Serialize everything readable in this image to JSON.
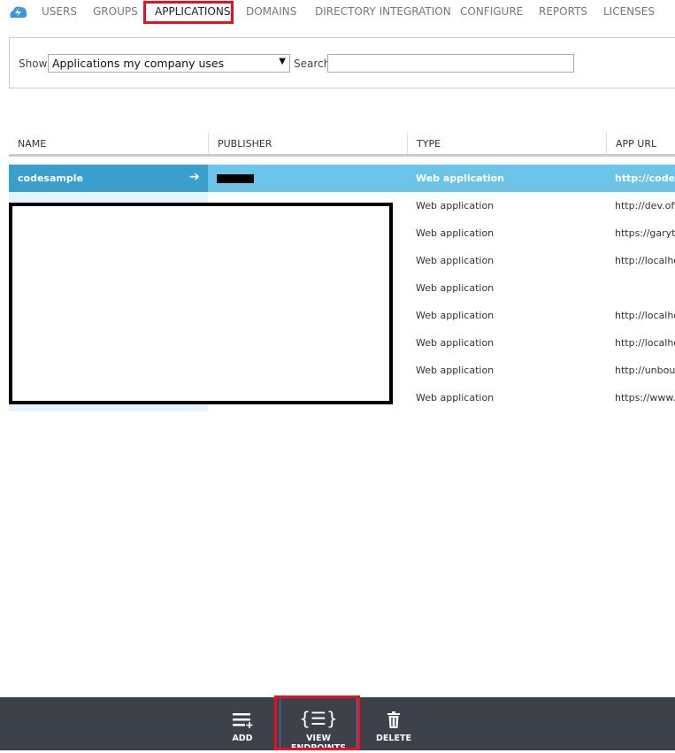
{
  "nav": {
    "items": [
      "USERS",
      "GROUPS",
      "APPLICATIONS",
      "DOMAINS",
      "DIRECTORY INTEGRATION",
      "CONFIGURE",
      "REPORTS",
      "LICENSES"
    ],
    "active": "APPLICATIONS"
  },
  "filter": {
    "show_label": "Show",
    "show_value": "Applications my company uses",
    "search_label": "Search",
    "search_value": ""
  },
  "table": {
    "columns": [
      "NAME",
      "PUBLISHER",
      "TYPE",
      "APP URL"
    ],
    "rows": [
      {
        "name": "codesample",
        "type": "Web application",
        "url": "http://codesam"
      },
      {
        "name": "",
        "type": "Web application",
        "url": "http://dev.offi"
      },
      {
        "name": "",
        "type": "Web application",
        "url": "https://garytes"
      },
      {
        "name": "",
        "type": "Web application",
        "url": "http://localhos"
      },
      {
        "name": "",
        "type": "Web application",
        "url": ""
      },
      {
        "name": "",
        "type": "Web application",
        "url": "http://localhos"
      },
      {
        "name": "",
        "type": "Web application",
        "url": "http://localhos"
      },
      {
        "name": "",
        "type": "Web application",
        "url": "http://unboun"
      },
      {
        "name": "",
        "type": "Web application",
        "url": "https://www.vi"
      }
    ]
  },
  "toolbar": {
    "add": "ADD",
    "view_endpoints": "VIEW ENDPOINTS",
    "delete": "DELETE"
  },
  "colors": {
    "selected_row": "#6cc4e9",
    "selected_name": "#3b9fce",
    "toolbar_bg": "#3c414a",
    "highlight": "#e81123"
  }
}
